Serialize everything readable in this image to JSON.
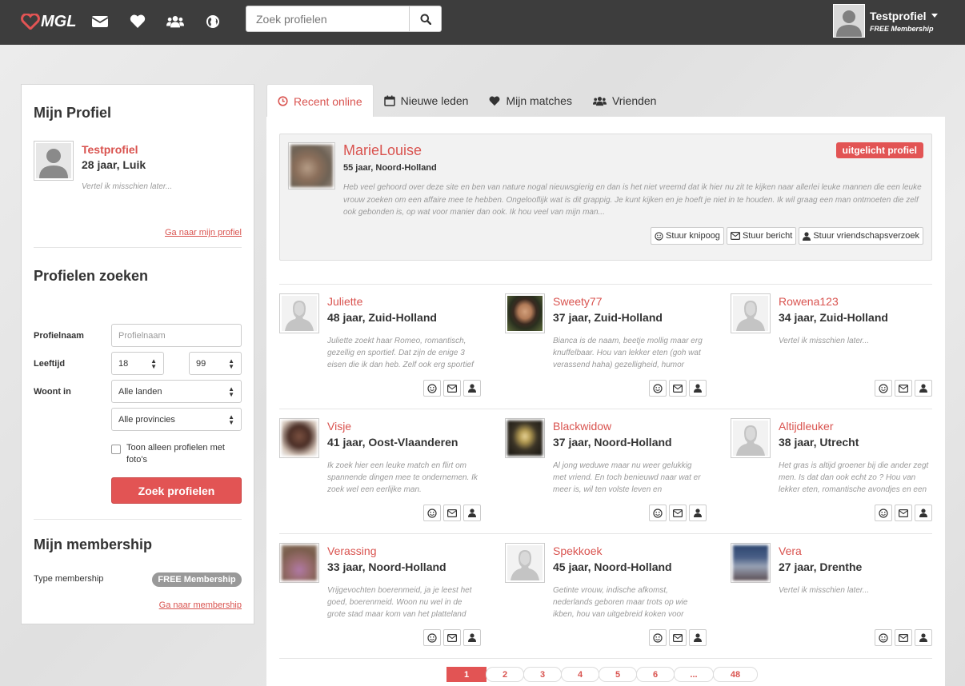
{
  "app": {
    "logo": "MGL"
  },
  "header": {
    "search_placeholder": "Zoek profielen",
    "user_name": "Testprofiel",
    "user_membership": "FREE Membership"
  },
  "sidebar": {
    "profile_heading": "Mijn Profiel",
    "profile_name": "Testprofiel",
    "profile_age": "28 jaar, Luik",
    "profile_desc": "Vertel ik misschien later...",
    "profile_link": "Ga naar mijn profiel",
    "search_heading": "Profielen zoeken",
    "label_name": "Profielnaam",
    "name_placeholder": "Profielnaam",
    "label_age": "Leeftijd",
    "age_min": "18",
    "age_max": "99",
    "label_lives": "Woont in",
    "country": "Alle landen",
    "province": "Alle provincies",
    "photo_only": "Toon alleen profielen met foto's",
    "search_button": "Zoek profielen",
    "membership_heading": "Mijn membership",
    "membership_type_label": "Type membership",
    "membership_badge": "FREE Membership",
    "membership_link": "Ga naar membership"
  },
  "tabs": [
    {
      "label": "Recent online",
      "icon": "clock-icon"
    },
    {
      "label": "Nieuwe leden",
      "icon": "calendar-icon"
    },
    {
      "label": "Mijn matches",
      "icon": "heart-icon"
    },
    {
      "label": "Vrienden",
      "icon": "users-icon"
    }
  ],
  "featured": {
    "name": "MarieLouise",
    "sub": "55 jaar, Noord-Holland",
    "tag": "uitgelicht profiel",
    "desc": "Heb veel gehoord over deze site en ben van nature nogal nieuwsgierig en dan is het niet vreemd dat ik hier nu zit te kijken naar allerlei leuke mannen die een leuke vrouw zoeken om een affaire mee te hebben. Ongelooflijk wat is dit grappig. Je kunt kijken en je hoeft je niet in te houden. Ik wil graag een man ontmoeten die zelf ook gebonden is, op wat voor manier dan ook. Ik hou veel van mijn man...",
    "btn_wink": "Stuur knipoog",
    "btn_message": "Stuur bericht",
    "btn_friend": "Stuur vriendschapsverzoek"
  },
  "profiles": [
    {
      "name": "Juliette",
      "age": "48 jaar, Zuid-Holland",
      "desc": "Juliette zoekt haar Romeo, romantisch, gezellig en sportief. Dat zijn de enige 3 eisen die ik dan heb. Zelf ook erg sportief",
      "photo": "silhouette"
    },
    {
      "name": "Sweety77",
      "age": "37 jaar, Zuid-Holland",
      "desc": "Bianca is de naam, beetje mollig maar erg knuffelbaar. Hou van lekker eten (goh wat verassend haha) gezelligheid, humor",
      "photo": "portrait"
    },
    {
      "name": "Rowena123",
      "age": "34 jaar, Zuid-Holland",
      "desc": "Vertel ik misschien later...",
      "photo": "silhouette"
    },
    {
      "name": "Visje",
      "age": "41 jaar, Oost-Vlaanderen",
      "desc": "Ik zoek hier een leuke match en flirt om spannende dingen mee te ondernemen. Ik zoek wel een eerlijke man.",
      "photo": "blur-brown"
    },
    {
      "name": "Blackwidow",
      "age": "37 jaar, Noord-Holland",
      "desc": "Al jong weduwe maar nu weer gelukkig met vriend. En toch benieuwd naar wat er meer is, wil ten volste leven en",
      "photo": "blur-dark"
    },
    {
      "name": "Altijdleuker",
      "age": "38 jaar, Utrecht",
      "desc": "Het gras is altijd groener bij die ander zegt men. Is dat dan ook echt zo ? Hou van lekker eten, romantische avondjes en een",
      "photo": "silhouette"
    },
    {
      "name": "Verassing",
      "age": "33 jaar, Noord-Holland",
      "desc": "Vrijgevochten boerenmeid, ja je leest het goed, boerenmeid. Woon nu wel in de grote stad maar kom van het platteland",
      "photo": "blur-pink"
    },
    {
      "name": "Spekkoek",
      "age": "45 jaar, Noord-Holland",
      "desc": "Getinte vrouw, indische afkomst, nederlands geboren maar trots op wie ikben, hou van uitgebreid koken voor",
      "photo": "silhouette"
    },
    {
      "name": "Vera",
      "age": "27 jaar, Drenthe",
      "desc": "Vertel ik misschien later...",
      "photo": "blur-blue"
    }
  ],
  "pagination": [
    "1",
    "2",
    "3",
    "4",
    "5",
    "6",
    "...",
    "48"
  ],
  "colors": {
    "accent": "#e25454",
    "link": "#d9534f",
    "topbar": "#3d3d3d"
  }
}
